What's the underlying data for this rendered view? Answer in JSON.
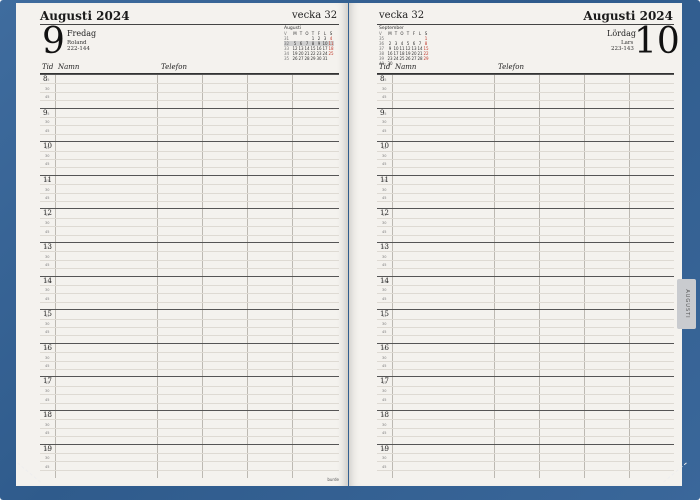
{
  "left_page": {
    "month_title": "Augusti 2024",
    "week_label": "vecka 32",
    "day_number": "9",
    "weekday": "Fredag",
    "name_day": "Roland",
    "day_count": "222-144",
    "columns": [
      "Tid",
      "Namn",
      "Telefon"
    ],
    "mini_calendar": {
      "title": "Augusti",
      "header": [
        "V",
        "M",
        "T",
        "O",
        "T",
        "F",
        "L",
        "S"
      ],
      "rows": [
        [
          "31",
          "",
          "",
          "",
          "1",
          "2",
          "3",
          "4"
        ],
        [
          "32",
          "5",
          "6",
          "7",
          "8",
          "9",
          "10",
          "11"
        ],
        [
          "33",
          "12",
          "13",
          "14",
          "15",
          "16",
          "17",
          "18"
        ],
        [
          "34",
          "19",
          "20",
          "21",
          "22",
          "23",
          "24",
          "25"
        ],
        [
          "35",
          "26",
          "27",
          "28",
          "29",
          "30",
          "31",
          ""
        ]
      ]
    },
    "brand": "burde"
  },
  "right_page": {
    "month_title": "Augusti 2024",
    "week_label": "vecka 32",
    "day_number": "10",
    "weekday": "Lördag",
    "name_day": "Lars",
    "day_count": "223-143",
    "columns": [
      "Tid",
      "Namn",
      "Telefon"
    ],
    "mini_calendar": {
      "title": "September",
      "header": [
        "V",
        "M",
        "T",
        "O",
        "T",
        "F",
        "L",
        "S"
      ],
      "rows": [
        [
          "35",
          "",
          "",
          "",
          "",
          "",
          "",
          "1"
        ],
        [
          "36",
          "2",
          "3",
          "4",
          "5",
          "6",
          "7",
          "8"
        ],
        [
          "37",
          "9",
          "10",
          "11",
          "12",
          "13",
          "14",
          "15"
        ],
        [
          "38",
          "16",
          "17",
          "18",
          "19",
          "20",
          "21",
          "22"
        ],
        [
          "39",
          "23",
          "24",
          "25",
          "26",
          "27",
          "28",
          "29"
        ],
        [
          "40",
          "30",
          "",
          "",
          "",
          "",
          "",
          ""
        ]
      ]
    },
    "month_tab": "AUGUSTI"
  },
  "hours": [
    "8",
    "9",
    "10",
    "11",
    "12",
    "13",
    "14",
    "15",
    "16",
    "17",
    "18",
    "19"
  ],
  "quarter_labels": [
    "15",
    "30",
    "45"
  ]
}
